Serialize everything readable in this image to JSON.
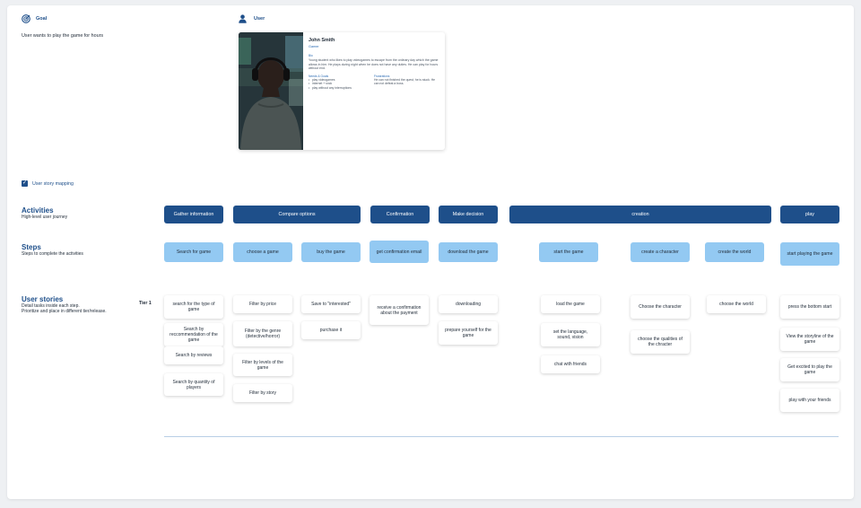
{
  "goal": {
    "label": "Goal",
    "text": "User wants to play the game for hours",
    "icon": "target-icon"
  },
  "user": {
    "label": "User",
    "icon": "person-icon",
    "persona": {
      "name": "John Smith",
      "role": "Gamer",
      "bio_heading": "Bio",
      "bio": "Young student who likes to play videogames to escape from the ordinary day which the game allows in him. He plays during night when he does not have any duties. He can play for hours without end.",
      "needs_heading": "Needs & Goals",
      "needs": [
        "play videogames",
        "internet + snck",
        "play without any interruptions"
      ],
      "frustrations_heading": "Frustrations",
      "frustrations": "He can not finished the quest, he is stuck. He can not defeat a boss."
    }
  },
  "story_mapping": {
    "label": "User story mapping",
    "check": "✓"
  },
  "rows": {
    "activities": {
      "title": "Activities",
      "subtitle": "High-level user journey"
    },
    "steps": {
      "title": "Steps",
      "subtitle": "Steps to complete the activities"
    },
    "stories": {
      "title": "User stories",
      "subtitle_1": "Detail tasks inside each step.",
      "subtitle_2": "Prioritize and place in different tier/release.",
      "tier": "Tier 1"
    }
  },
  "activities": [
    "Gather information",
    "Compare options",
    "Confirmation",
    "Make decision",
    "creation",
    "play"
  ],
  "steps": [
    "Search for game",
    "choose a game",
    "buy the game",
    "get confirmation email",
    "download the game",
    "start the game",
    "create a character",
    "create the world",
    "start playing the game"
  ],
  "stories": [
    [
      "search for the type of game",
      "Search by reccommendation of the game",
      "Search by reviews",
      "Search by quantity of players"
    ],
    [
      "Filter by price",
      "Filter by the genre (detective/horror)",
      "Filter by levels of the game",
      "Filter by story"
    ],
    [
      "Save to \"interested\"",
      "purchase it"
    ],
    [
      "receive a confirmation about the payment"
    ],
    [
      "downloading",
      "prepare yourself for the game"
    ],
    [
      "load the game",
      "set the language, sound, vision",
      "chat with friends"
    ],
    [
      "Choose the character",
      "choose the qualities of the chracter"
    ],
    [
      "choose the world"
    ],
    [
      "press the bottom start",
      "View the storyline of the game",
      "Get excited to play the game",
      "play with your friends"
    ]
  ],
  "colors": {
    "activity": "#1e4f8a",
    "step": "#93c9f2",
    "accent_text": "#1e4f8a"
  }
}
